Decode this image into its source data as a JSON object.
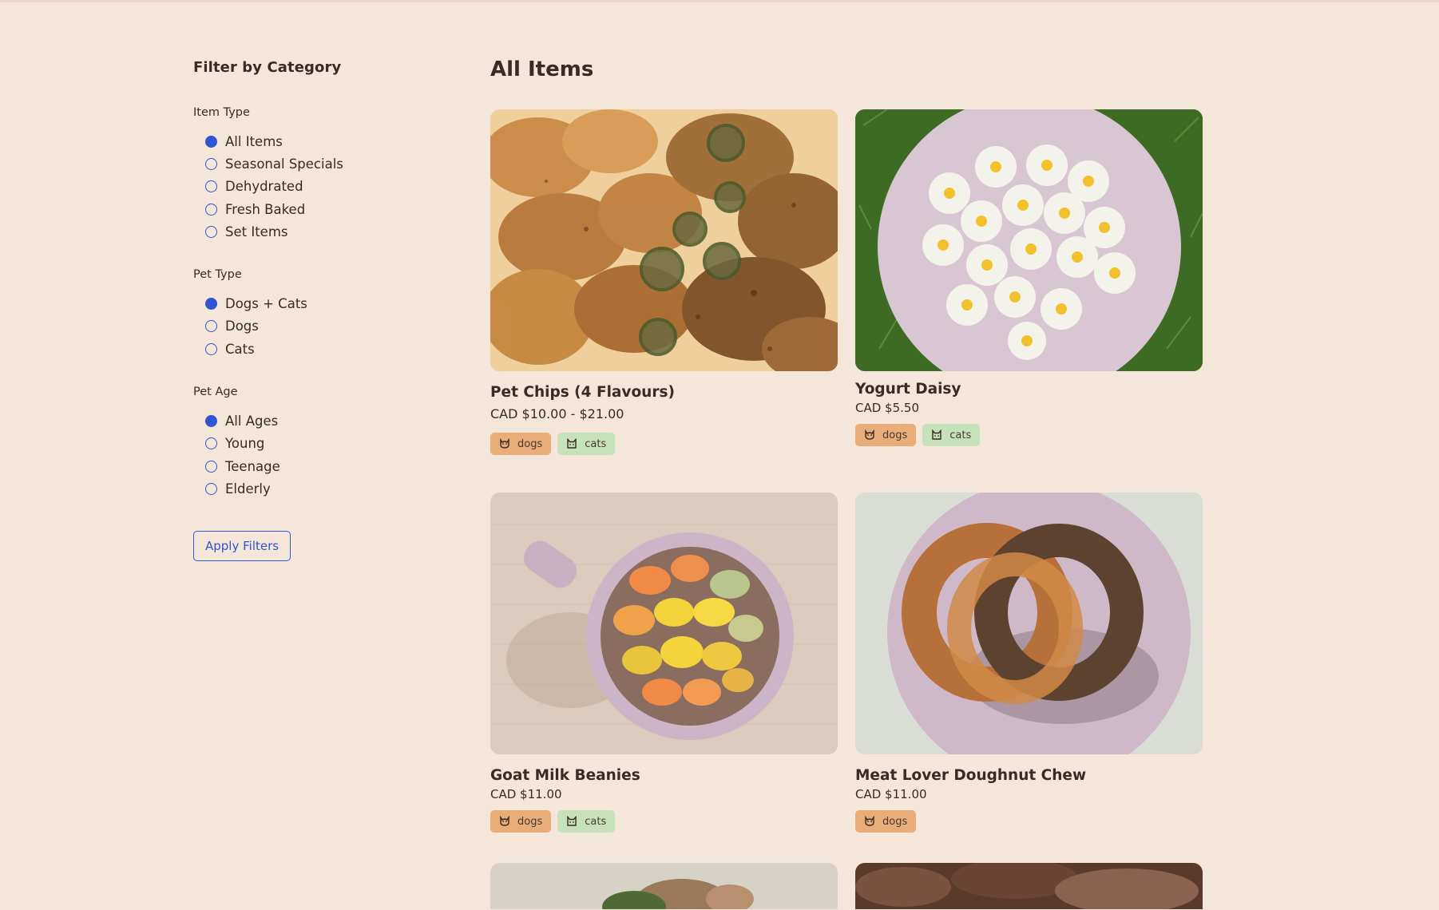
{
  "sidebar": {
    "title": "Filter by Category",
    "groups": [
      {
        "title": "Item Type",
        "options": [
          "All Items",
          "Seasonal Specials",
          "Dehydrated",
          "Fresh Baked",
          "Set Items"
        ],
        "selected": "All Items"
      },
      {
        "title": "Pet Type",
        "options": [
          "Dogs + Cats",
          "Dogs",
          "Cats"
        ],
        "selected": "Dogs + Cats"
      },
      {
        "title": "Pet Age",
        "options": [
          "All Ages",
          "Young",
          "Teenage",
          "Elderly"
        ],
        "selected": "All Ages"
      }
    ],
    "apply_label": "Apply Filters"
  },
  "main": {
    "title": "All Items",
    "products": [
      {
        "name": "Pet Chips (4 Flavours)",
        "price": "CAD $10.00 - $21.00",
        "tags": [
          "dogs",
          "cats"
        ]
      },
      {
        "name": "Yogurt Daisy",
        "price": "CAD $5.50",
        "tags": [
          "dogs",
          "cats"
        ]
      },
      {
        "name": "Goat Milk Beanies",
        "price": "CAD $11.00",
        "tags": [
          "dogs",
          "cats"
        ]
      },
      {
        "name": "Meat Lover Doughnut Chew",
        "price": "CAD $11.00",
        "tags": [
          "dogs"
        ]
      }
    ],
    "tag_icons": {
      "dogs": "dog-face-icon",
      "cats": "cat-face-icon"
    }
  },
  "colors": {
    "accent": "#2f55d4",
    "background": "#f4e6d8",
    "tag_dogs": "#e8ad78",
    "tag_cats": "#c5e2bb"
  }
}
